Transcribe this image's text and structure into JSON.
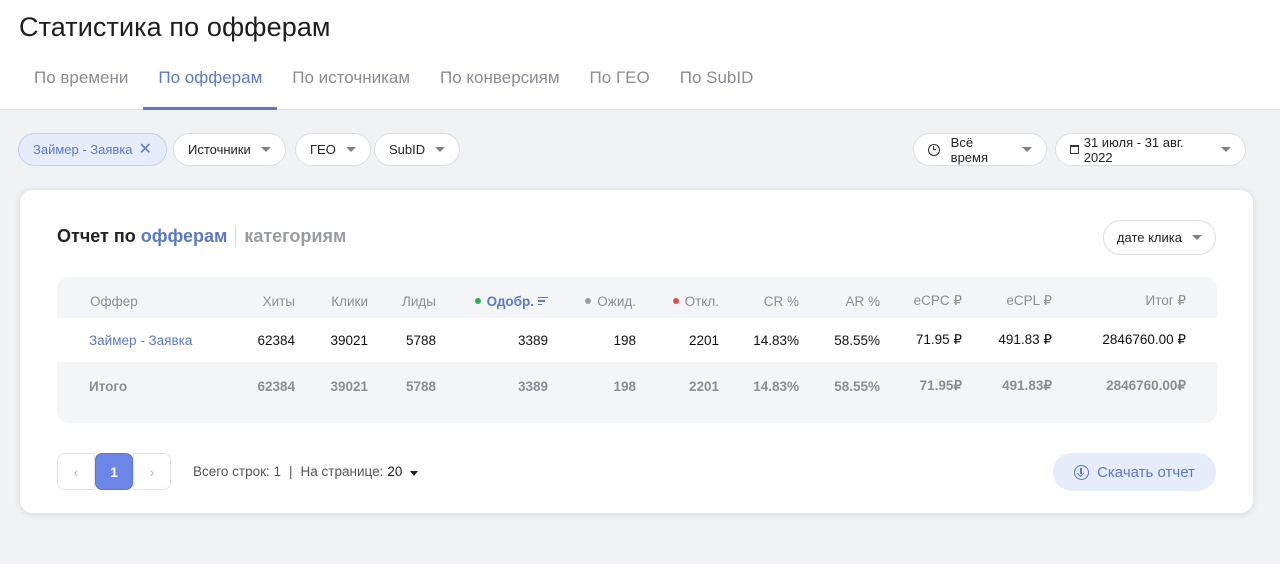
{
  "page": {
    "title": "Статистика по офферам"
  },
  "tabs": [
    {
      "label": "По времени"
    },
    {
      "label": "По офферам",
      "active": true
    },
    {
      "label": "По источникам"
    },
    {
      "label": "По конверсиям"
    },
    {
      "label": "По ГЕО"
    },
    {
      "label": "По SubID"
    }
  ],
  "filters": {
    "offer_chip": "Займер - Заявка",
    "sources": "Источники",
    "geo": "ГЕО",
    "subid": "SubID",
    "period": "Всё время",
    "date_range": "31 июля - 31 авг. 2022"
  },
  "report": {
    "title_prefix": "Отчет по",
    "title_link": "офферам",
    "title_alt": "категориям",
    "date_mode": "дате клика"
  },
  "table": {
    "headers": {
      "offer": "Оффер",
      "hits": "Хиты",
      "clicks": "Клики",
      "leads": "Лиды",
      "approved": "Одобр.",
      "pending": "Ожид.",
      "rejected": "Откл.",
      "cr": "CR %",
      "ar": "AR %",
      "ecpc": "eCPC ₽",
      "ecpl": "eCPL ₽",
      "total": "Итог ₽"
    },
    "row": {
      "offer": "Займер - Заявка",
      "hits": "62384",
      "clicks": "39021",
      "leads": "5788",
      "approved": "3389",
      "pending": "198",
      "rejected": "2201",
      "cr": "14.83%",
      "ar": "58.55%",
      "ecpc": "71.95 ₽",
      "ecpl": "491.83 ₽",
      "total": "2846760.00 ₽"
    },
    "totals": {
      "offer": "Итого",
      "hits": "62384",
      "clicks": "39021",
      "leads": "5788",
      "approved": "3389",
      "pending": "198",
      "rejected": "2201",
      "cr": "14.83%",
      "ar": "58.55%",
      "ecpc": "71.95₽",
      "ecpl": "491.83₽",
      "total": "2846760.00₽"
    }
  },
  "status_colors": {
    "approved": "#2bb24c",
    "pending": "#9a9ca1",
    "rejected": "#e5484d"
  },
  "pagination": {
    "current_page": "1",
    "prev": "‹",
    "next": "›",
    "total_rows": "Всего строк: 1",
    "separator": "|",
    "per_page_label": "На странице:",
    "per_page_value": "20"
  },
  "download": {
    "label": "Скачать отчет"
  }
}
